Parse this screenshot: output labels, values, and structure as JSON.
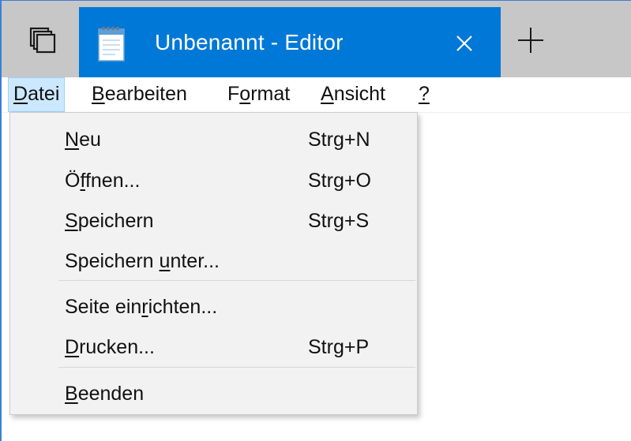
{
  "window": {
    "tab_title": "Unbenannt - Editor",
    "icons": {
      "tabs": "tabs-overview-icon",
      "app": "notepad-icon",
      "close": "close-icon",
      "new_tab": "plus-icon"
    },
    "colors": {
      "accent": "#0078d7",
      "titlebar_bg": "#c7c7c7",
      "menu_highlight": "#cce8ff",
      "dropdown_bg": "#f2f2f2"
    }
  },
  "menubar": {
    "items": [
      {
        "pre": "",
        "key": "D",
        "post": "atei",
        "open": true
      },
      {
        "pre": "",
        "key": "B",
        "post": "earbeiten",
        "open": false
      },
      {
        "pre": "F",
        "key": "o",
        "post": "rmat",
        "open": false
      },
      {
        "pre": "",
        "key": "A",
        "post": "nsicht",
        "open": false
      },
      {
        "pre": "",
        "key": "?",
        "post": "",
        "open": false
      }
    ]
  },
  "file_menu": {
    "items": [
      {
        "pre": "",
        "key": "N",
        "post": "eu",
        "shortcut": "Strg+N"
      },
      {
        "pre": "Ö",
        "key": "f",
        "post": "fnen...",
        "shortcut": "Strg+O"
      },
      {
        "pre": "",
        "key": "S",
        "post": "peichern",
        "shortcut": "Strg+S"
      },
      {
        "pre": "Speichern ",
        "key": "u",
        "post": "nter...",
        "shortcut": ""
      },
      {
        "pre": "Seite ein",
        "key": "r",
        "post": "ichten...",
        "shortcut": ""
      },
      {
        "pre": "",
        "key": "D",
        "post": "rucken...",
        "shortcut": "Strg+P"
      },
      {
        "pre": "",
        "key": "B",
        "post": "eenden",
        "shortcut": ""
      }
    ]
  }
}
